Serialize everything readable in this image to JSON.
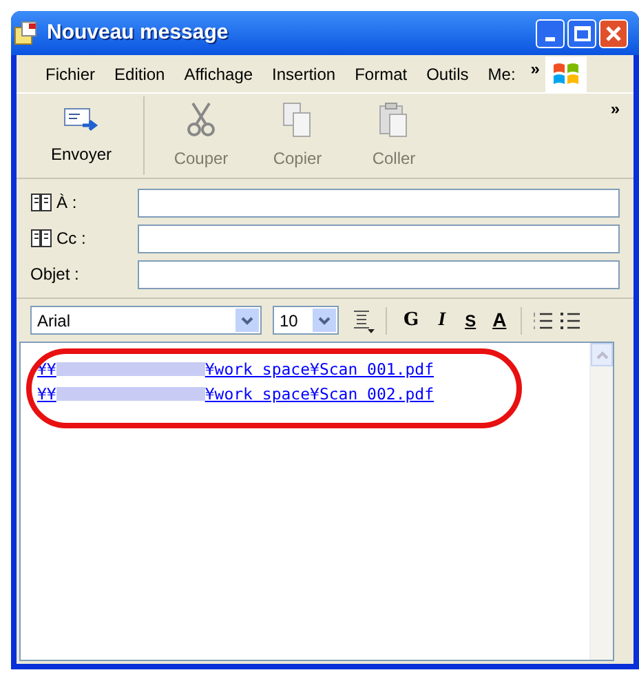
{
  "window": {
    "title": "Nouveau message"
  },
  "menu": [
    "Fichier",
    "Edition",
    "Affichage",
    "Insertion",
    "Format",
    "Outils",
    "Me:"
  ],
  "menu_overflow": "»",
  "toolbar": [
    {
      "label": "Envoyer",
      "kind": "send",
      "disabled": false
    },
    {
      "label": "Couper",
      "kind": "cut",
      "disabled": true
    },
    {
      "label": "Copier",
      "kind": "copy",
      "disabled": true
    },
    {
      "label": "Coller",
      "kind": "paste",
      "disabled": true
    }
  ],
  "toolbar_overflow": "»",
  "fields": [
    {
      "label": "À :",
      "kind": "address"
    },
    {
      "label": "Cc :",
      "kind": "address"
    },
    {
      "label": "Objet :",
      "kind": "plain"
    }
  ],
  "format_bar": {
    "font": "Arial",
    "size": "10",
    "bold": "G",
    "italic": "I",
    "underline": "S",
    "font_color": "A"
  },
  "body": {
    "links": [
      {
        "prefix": "¥¥",
        "suffix": "¥work space¥Scan 001.pdf"
      },
      {
        "prefix": "¥¥",
        "suffix": "¥work space¥Scan 002.pdf"
      }
    ]
  }
}
